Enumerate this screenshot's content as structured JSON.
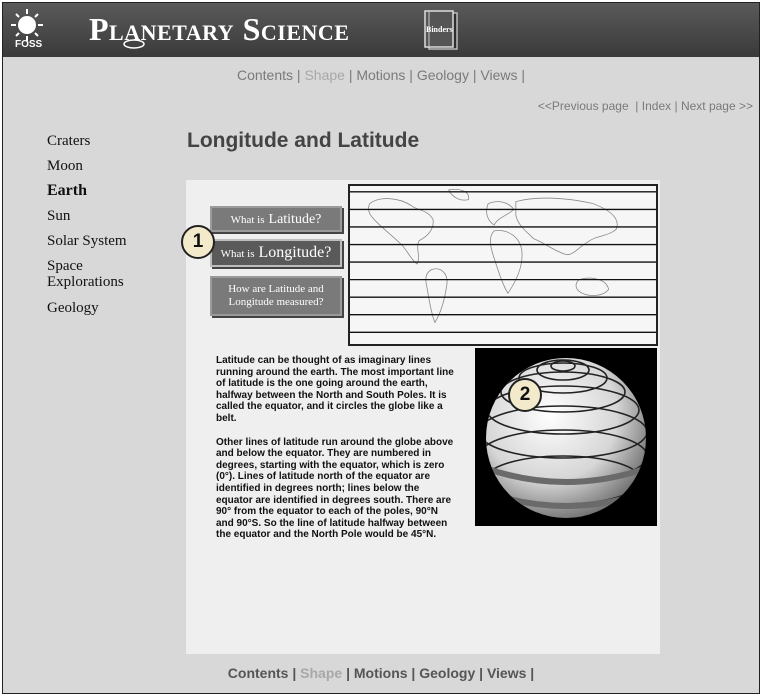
{
  "header": {
    "logo_text": "FOSS",
    "title": "Planetary Science",
    "binder_label": "Binders"
  },
  "nav": {
    "items": [
      "Contents",
      "Shape",
      "Motions",
      "Geology",
      "Views"
    ],
    "separator": "|",
    "active": "Shape"
  },
  "pager": {
    "previous": "<<Previous page",
    "index": "Index",
    "next": "Next page >>"
  },
  "sidebar": {
    "items": [
      {
        "label": "Craters"
      },
      {
        "label": "Moon"
      },
      {
        "label": "Earth"
      },
      {
        "label": "Sun"
      },
      {
        "label": "Solar System"
      },
      {
        "label": "Space Explorations"
      },
      {
        "label": "Geology"
      }
    ],
    "current": "Earth"
  },
  "page_title": "Longitude and Latitude",
  "buttons": {
    "latitude_small": "What is",
    "latitude_big": "Latitude?",
    "longitude_small": "What is",
    "longitude_big": "Longitude?",
    "measured_line1": "How are Latitude and",
    "measured_line2": "Longitude measured?"
  },
  "markers": {
    "one": "1",
    "two": "2"
  },
  "body_text": {
    "paragraph1": "Latitude can be thought of as imaginary lines running around the earth.  The most important line of latitude is the one going around the earth, halfway between the North and South Poles.  It is called the equator, and it circles the globe like a belt.",
    "paragraph2": "Other lines of latitude run around the globe above and below the equator.  They are numbered in degrees, starting with the equator, which is zero (0°).  Lines of latitude north of the equator are identified in degrees north; lines below the equator are identified in degrees south.  There are 90° from the equator to each of the poles, 90°N and 90°S.  So the line of latitude halfway between the equator and the North Pole would be 45°N."
  },
  "colors": {
    "banner": "#4a4a4a",
    "panel": "#efefef",
    "background": "#d8d8d8",
    "button": "#7a7a7a",
    "marker": "#f2eacb"
  }
}
